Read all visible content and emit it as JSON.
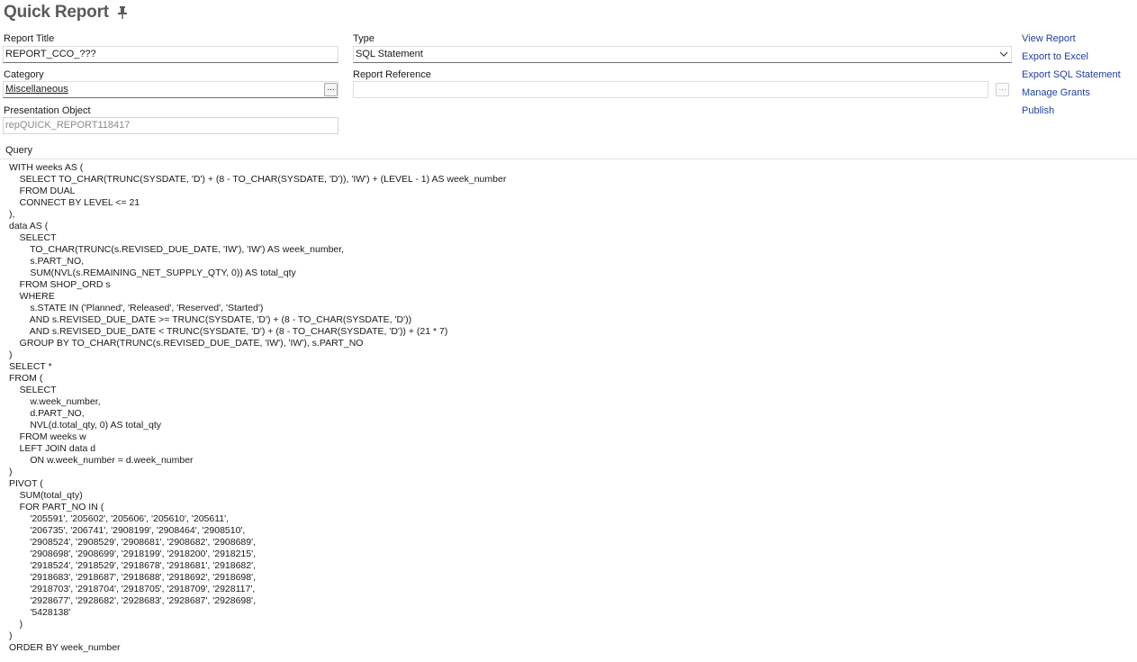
{
  "header": {
    "title": "Quick Report"
  },
  "form": {
    "report_title": {
      "label": "Report Title",
      "value": "REPORT_CCO_???"
    },
    "type": {
      "label": "Type",
      "value": "SQL Statement"
    },
    "category": {
      "label": "Category",
      "value": "Miscellaneous",
      "browse": "..."
    },
    "report_reference": {
      "label": "Report Reference",
      "value": "",
      "browse": "..."
    },
    "presentation_object": {
      "label": "Presentation Object",
      "value": "repQUICK_REPORT118417"
    }
  },
  "actions": [
    "View Report",
    "Export to Excel",
    "Export SQL Statement",
    "Manage Grants",
    "Publish"
  ],
  "query": {
    "label": "Query",
    "lines": [
      "WITH weeks AS (",
      "    SELECT TO_CHAR(TRUNC(SYSDATE, 'D') + (8 - TO_CHAR(SYSDATE, 'D')), 'IW') + (LEVEL - 1) AS week_number",
      "    FROM DUAL",
      "    CONNECT BY LEVEL <= 21",
      "),",
      "data AS (",
      "    SELECT",
      "        TO_CHAR(TRUNC(s.REVISED_DUE_DATE, 'IW'), 'IW') AS week_number,",
      "        s.PART_NO,",
      "        SUM(NVL(s.REMAINING_NET_SUPPLY_QTY, 0)) AS total_qty",
      "    FROM SHOP_ORD s",
      "    WHERE",
      "        s.STATE IN ('Planned', 'Released', 'Reserved', 'Started')",
      "        AND s.REVISED_DUE_DATE >= TRUNC(SYSDATE, 'D') + (8 - TO_CHAR(SYSDATE, 'D'))",
      "        AND s.REVISED_DUE_DATE < TRUNC(SYSDATE, 'D') + (8 - TO_CHAR(SYSDATE, 'D')) + (21 * 7)",
      "    GROUP BY TO_CHAR(TRUNC(s.REVISED_DUE_DATE, 'IW'), 'IW'), s.PART_NO",
      ")",
      "SELECT *",
      "FROM (",
      "    SELECT",
      "        w.week_number,",
      "        d.PART_NO,",
      "        NVL(d.total_qty, 0) AS total_qty",
      "    FROM weeks w",
      "    LEFT JOIN data d",
      "        ON w.week_number = d.week_number",
      ")",
      "PIVOT (",
      "    SUM(total_qty)",
      "    FOR PART_NO IN (",
      "        '205591', '205602', '205606', '205610', '205611',",
      "        '206735', '206741', '2908199', '2908464', '2908510',",
      "        '2908524', '2908529', '2908681', '2908682', '2908689',",
      "        '2908698', '2908699', '2918199', '2918200', '2918215',",
      "        '2918524', '2918529', '2918678', '2918681', '2918682',",
      "        '2918683', '2918687', '2918688', '2918692', '2918698',",
      "        '2918703', '2918704', '2918705', '2918709', '2928117',",
      "        '2928677', '2928682', '2928683', '2928687', '2928698',",
      "        '5428138'",
      "    )",
      ")",
      "ORDER BY week_number"
    ]
  },
  "icons": {
    "pin": "pin-icon",
    "dropdown": "chevron-down-icon"
  },
  "colors": {
    "link": "#1f3f9c",
    "title": "#5a5a5a",
    "readonly_text": "#8a8a8a"
  }
}
